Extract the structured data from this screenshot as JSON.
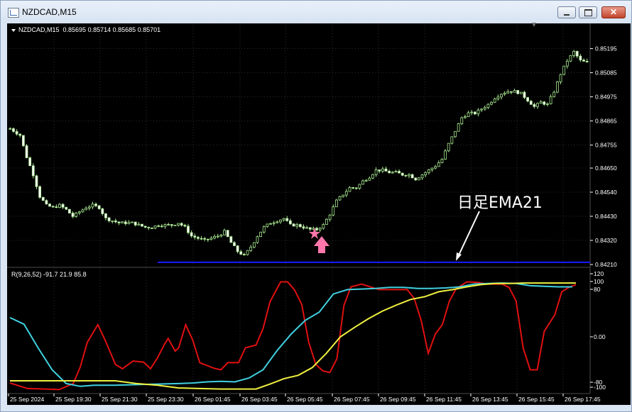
{
  "window": {
    "title": "NZDCAD,M15",
    "symbol_label": "NZDCAD,M15",
    "ohlc": "0.85695 0.85714 0.85685 0.85701",
    "indicator_label": "R(9,26,52)",
    "indicator_values": "-91.7 21.9 85.8",
    "annotation_text": "日足EMA21"
  },
  "colors": {
    "background": "#000000",
    "candle": "#a8e890",
    "level_line": "#1a1aff",
    "red_line": "#e01010",
    "cyan_line": "#40d0e0",
    "yellow_line": "#f0f040",
    "marker_star": "#ff77aa",
    "marker_arrow": "#ff77aa",
    "text": "#ffffff"
  },
  "icons": {
    "window": "chart-window-icon",
    "minimize": "minimize-icon",
    "maximize": "maximize-icon",
    "close": "close-icon",
    "menu": "triangle-down-icon",
    "signal": "star-icon",
    "buy": "arrow-up-icon",
    "pointer": "pointer-arrow-icon"
  },
  "chart_data": [
    {
      "type": "candlestick",
      "ylim": [
        0.8415,
        0.853
      ],
      "yticks": [
        "0.85195",
        "0.85085",
        "0.84975",
        "0.84865",
        "0.84755",
        "0.84650",
        "0.84540",
        "0.84430",
        "0.84320",
        "0.84210"
      ],
      "xticks": [
        "25 Sep 2024",
        "25 Sep 19:30",
        "25 Sep 21:30",
        "25 Sep 23:30",
        "26 Sep 01:45",
        "26 Sep 03:45",
        "26 Sep 05:45",
        "26 Sep 07:45",
        "26 Sep 09:45",
        "26 Sep 11:45",
        "26 Sep 13:45",
        "26 Sep 15:45",
        "26 Sep 17:45"
      ],
      "close_path": [
        [
          0,
          0.8483
        ],
        [
          3,
          0.848
        ],
        [
          5,
          0.847
        ],
        [
          7,
          0.8462
        ],
        [
          9,
          0.8452
        ],
        [
          11,
          0.8448
        ],
        [
          13,
          0.8447
        ],
        [
          15,
          0.8448
        ],
        [
          17,
          0.8446
        ],
        [
          19,
          0.8443
        ],
        [
          21,
          0.8445
        ],
        [
          23,
          0.8447
        ],
        [
          25,
          0.8448
        ],
        [
          27,
          0.8447
        ],
        [
          29,
          0.8442
        ],
        [
          31,
          0.8441
        ],
        [
          33,
          0.844
        ],
        [
          35,
          0.844
        ],
        [
          37,
          0.844
        ],
        [
          39,
          0.8439
        ],
        [
          41,
          0.8438
        ],
        [
          43,
          0.8438
        ],
        [
          45,
          0.8439
        ],
        [
          47,
          0.8439
        ],
        [
          49,
          0.8439
        ],
        [
          51,
          0.844
        ],
        [
          53,
          0.8438
        ],
        [
          55,
          0.8434
        ],
        [
          57,
          0.8433
        ],
        [
          59,
          0.8432
        ],
        [
          61,
          0.8433
        ],
        [
          63,
          0.8434
        ],
        [
          65,
          0.8436
        ],
        [
          67,
          0.8431
        ],
        [
          69,
          0.8427
        ],
        [
          71,
          0.8425
        ],
        [
          73,
          0.8429
        ],
        [
          75,
          0.8434
        ],
        [
          77,
          0.8438
        ],
        [
          79,
          0.844
        ],
        [
          81,
          0.8441
        ],
        [
          83,
          0.8442
        ],
        [
          85,
          0.8439
        ],
        [
          87,
          0.8439
        ],
        [
          89,
          0.8438
        ],
        [
          91,
          0.8437
        ],
        [
          93,
          0.8437
        ],
        [
          95,
          0.8439
        ],
        [
          97,
          0.8444
        ],
        [
          99,
          0.845
        ],
        [
          101,
          0.8453
        ],
        [
          103,
          0.8456
        ],
        [
          105,
          0.8456
        ],
        [
          107,
          0.8459
        ],
        [
          109,
          0.8461
        ],
        [
          111,
          0.8464
        ],
        [
          113,
          0.8464
        ],
        [
          115,
          0.8463
        ],
        [
          117,
          0.8463
        ],
        [
          119,
          0.8462
        ],
        [
          121,
          0.8462
        ],
        [
          123,
          0.846
        ],
        [
          125,
          0.8462
        ],
        [
          127,
          0.8464
        ],
        [
          129,
          0.8466
        ],
        [
          131,
          0.8469
        ],
        [
          133,
          0.8476
        ],
        [
          135,
          0.8482
        ],
        [
          137,
          0.8488
        ],
        [
          139,
          0.849
        ],
        [
          141,
          0.849
        ],
        [
          143,
          0.8492
        ],
        [
          145,
          0.8494
        ],
        [
          147,
          0.8497
        ],
        [
          149,
          0.8499
        ],
        [
          151,
          0.85
        ],
        [
          153,
          0.85
        ],
        [
          155,
          0.8499
        ],
        [
          157,
          0.8496
        ],
        [
          159,
          0.8493
        ],
        [
          161,
          0.8495
        ],
        [
          163,
          0.8494
        ],
        [
          165,
          0.85
        ],
        [
          167,
          0.8508
        ],
        [
          169,
          0.8514
        ],
        [
          171,
          0.8518
        ],
        [
          173,
          0.8514
        ],
        [
          175,
          0.8513
        ]
      ],
      "horizontal_line": 0.8422
    },
    {
      "type": "line",
      "ylim": [
        -100,
        120
      ],
      "yticks": [
        "120",
        "100",
        "80",
        "0.00",
        "-80",
        "-100"
      ],
      "series": [
        {
          "color": "red",
          "points": [
            [
              0,
              -84
            ],
            [
              3,
              -90
            ],
            [
              5,
              -94
            ],
            [
              10,
              -95
            ],
            [
              14,
              -96
            ],
            [
              18,
              -85
            ],
            [
              20,
              -55
            ],
            [
              22,
              -10
            ],
            [
              25,
              22
            ],
            [
              27,
              -5
            ],
            [
              30,
              -50
            ],
            [
              32,
              -58
            ],
            [
              35,
              -44
            ],
            [
              38,
              -46
            ],
            [
              40,
              -58
            ],
            [
              42,
              -38
            ],
            [
              44,
              -13
            ],
            [
              45,
              -3
            ],
            [
              47,
              -26
            ],
            [
              48,
              -20
            ],
            [
              50,
              22
            ],
            [
              52,
              -6
            ],
            [
              54,
              -47
            ],
            [
              58,
              -57
            ],
            [
              60,
              -60
            ],
            [
              62,
              -47
            ],
            [
              65,
              -47
            ],
            [
              67,
              -20
            ],
            [
              70,
              -15
            ],
            [
              72,
              15
            ],
            [
              74,
              64
            ],
            [
              77,
              100
            ],
            [
              79,
              100
            ],
            [
              81,
              85
            ],
            [
              83,
              59
            ],
            [
              85,
              -10
            ],
            [
              87,
              -50
            ],
            [
              89,
              -62
            ],
            [
              91,
              -65
            ],
            [
              93,
              -40
            ],
            [
              95,
              57
            ],
            [
              97,
              91
            ],
            [
              100,
              96
            ],
            [
              105,
              86
            ],
            [
              110,
              86
            ],
            [
              113,
              86
            ],
            [
              115,
              70
            ],
            [
              117,
              30
            ],
            [
              119,
              -30
            ],
            [
              121,
              5
            ],
            [
              123,
              22
            ],
            [
              125,
              65
            ],
            [
              127,
              88
            ],
            [
              130,
              100
            ],
            [
              133,
              99
            ],
            [
              136,
              96
            ],
            [
              138,
              96
            ],
            [
              140,
              96
            ],
            [
              142,
              90
            ],
            [
              144,
              65
            ],
            [
              146,
              -20
            ],
            [
              148,
              -60
            ],
            [
              150,
              -60
            ],
            [
              152,
              10
            ],
            [
              155,
              40
            ],
            [
              157,
              82
            ],
            [
              159,
              90
            ],
            [
              161,
              95
            ]
          ]
        },
        {
          "color": "cyan",
          "points": [
            [
              0,
              35
            ],
            [
              4,
              23
            ],
            [
              8,
              -20
            ],
            [
              12,
              -60
            ],
            [
              16,
              -85
            ],
            [
              20,
              -90
            ],
            [
              24,
              -88
            ],
            [
              30,
              -88
            ],
            [
              36,
              -87
            ],
            [
              42,
              -86
            ],
            [
              48,
              -85
            ],
            [
              52,
              -84
            ],
            [
              56,
              -82
            ],
            [
              60,
              -81
            ],
            [
              64,
              -82
            ],
            [
              68,
              -75
            ],
            [
              72,
              -60
            ],
            [
              76,
              -25
            ],
            [
              80,
              5
            ],
            [
              84,
              30
            ],
            [
              88,
              45
            ],
            [
              92,
              78
            ],
            [
              96,
              86
            ],
            [
              100,
              87
            ],
            [
              104,
              88
            ],
            [
              108,
              90
            ],
            [
              112,
              90
            ],
            [
              116,
              88
            ],
            [
              120,
              88
            ],
            [
              124,
              89
            ],
            [
              128,
              91
            ],
            [
              132,
              96
            ],
            [
              136,
              97
            ],
            [
              140,
              98
            ],
            [
              144,
              97
            ],
            [
              148,
              93
            ],
            [
              152,
              92
            ],
            [
              156,
              91
            ],
            [
              160,
              91
            ]
          ]
        },
        {
          "color": "yellow",
          "points": [
            [
              0,
              -80
            ],
            [
              10,
              -80
            ],
            [
              20,
              -80
            ],
            [
              30,
              -80
            ],
            [
              36,
              -85
            ],
            [
              42,
              -88
            ],
            [
              48,
              -93
            ],
            [
              54,
              -94
            ],
            [
              60,
              -95
            ],
            [
              66,
              -95
            ],
            [
              70,
              -95
            ],
            [
              74,
              -86
            ],
            [
              78,
              -76
            ],
            [
              82,
              -70
            ],
            [
              86,
              -56
            ],
            [
              90,
              -30
            ],
            [
              94,
              0
            ],
            [
              98,
              17
            ],
            [
              102,
              33
            ],
            [
              106,
              47
            ],
            [
              110,
              58
            ],
            [
              114,
              68
            ],
            [
              118,
              73
            ],
            [
              122,
              82
            ],
            [
              126,
              86
            ],
            [
              130,
              91
            ],
            [
              134,
              95
            ],
            [
              138,
              97
            ],
            [
              142,
              97
            ],
            [
              146,
              98
            ],
            [
              150,
              98
            ],
            [
              154,
              98
            ],
            [
              158,
              98
            ],
            [
              161,
              98
            ]
          ]
        }
      ]
    }
  ]
}
